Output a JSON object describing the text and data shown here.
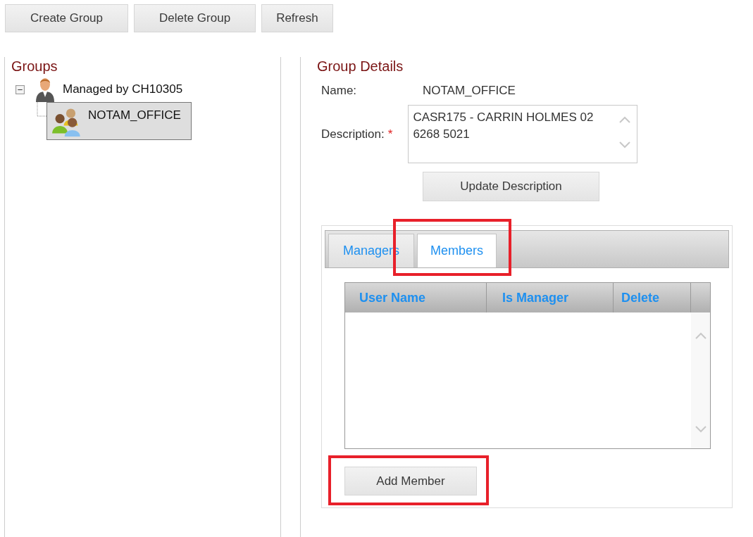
{
  "toolbar": {
    "buttons": [
      "Create Group",
      "Delete Group",
      "Refresh"
    ]
  },
  "groups_panel": {
    "title": "Groups",
    "tree": [
      {
        "label": "Managed by CH10305",
        "kind": "manager",
        "expanded": true,
        "selected": false,
        "children": [
          {
            "label": "NOTAM_OFFICE",
            "kind": "group",
            "selected": true
          }
        ]
      }
    ]
  },
  "details": {
    "title": "Group Details",
    "name_label": "Name:",
    "name_value": "NOTAM_OFFICE",
    "description_label": "Description:",
    "required_mark": "*",
    "description": "CASR175 - CARRIN HOLMES 02 6268 5021",
    "update_button": "Update Description",
    "tabs": [
      {
        "label": "Managers",
        "selected": false,
        "highlighted": false
      },
      {
        "label": "Members",
        "selected": true,
        "highlighted": true
      }
    ],
    "table": {
      "columns": [
        "User Name",
        "Is Manager",
        "Delete"
      ]
    },
    "add_button": {
      "label": "Add Member",
      "highlighted": true
    }
  }
}
